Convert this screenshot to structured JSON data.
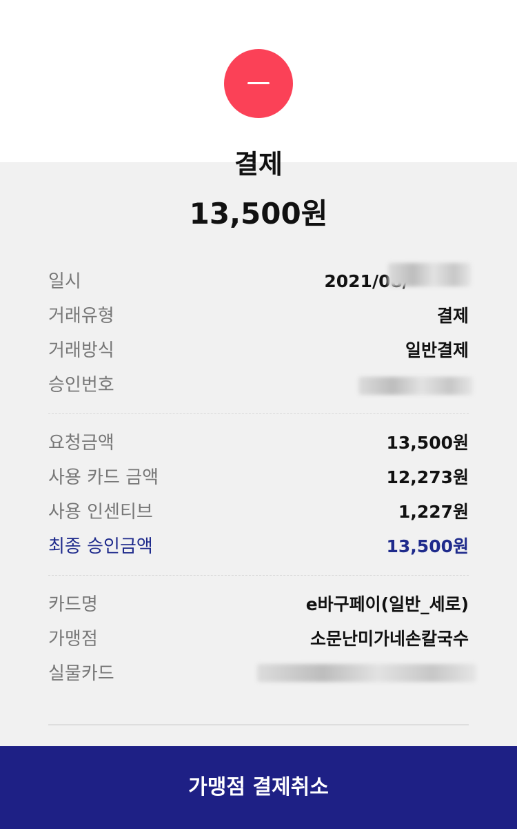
{
  "status": {
    "icon": "minus-icon",
    "icon_color": "#fb4157",
    "title": "결제",
    "amount": "13,500원"
  },
  "details": [
    {
      "label": "일시",
      "value": "2021/08/",
      "redacted": true
    },
    {
      "label": "거래유형",
      "value": "결제"
    },
    {
      "label": "거래방식",
      "value": "일반결제"
    },
    {
      "label": "승인번호",
      "value": "",
      "redacted": true
    }
  ],
  "amounts": [
    {
      "label": "요청금액",
      "value": "13,500원"
    },
    {
      "label": "사용 카드 금액",
      "value": "12,273원"
    },
    {
      "label": "사용 인센티브",
      "value": "1,227원"
    },
    {
      "label": "최종 승인금액",
      "value": "13,500원",
      "accent": true
    }
  ],
  "card_info": [
    {
      "label": "카드명",
      "value": "e바구페이(일반_세로)"
    },
    {
      "label": "가맹점",
      "value": "소문난미가네손칼국수"
    },
    {
      "label": "실물카드",
      "value": "",
      "redacted": true
    }
  ],
  "colors": {
    "accent": "#1f2b8c",
    "button_bg": "#1e2085",
    "background": "#f1f1f1"
  },
  "actions": {
    "cancel_label": "가맹점 결제취소"
  }
}
